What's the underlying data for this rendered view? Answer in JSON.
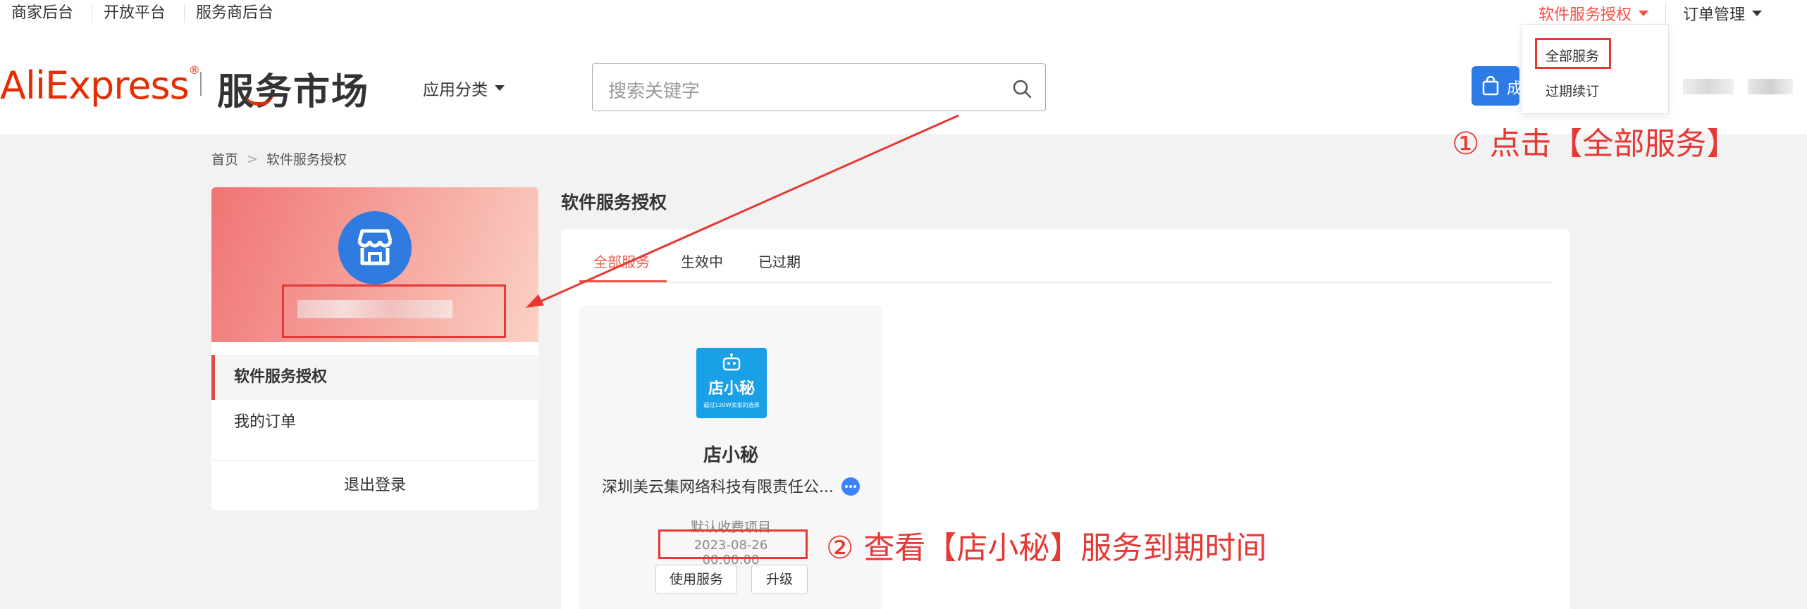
{
  "topbar": {
    "links": [
      "商家后台",
      "开放平台",
      "服务商后台"
    ],
    "auth_menu": "软件服务授权",
    "order_menu": "订单管理"
  },
  "header": {
    "logo_text": "AliExpress",
    "logo_sup": "®",
    "logo_cn": "服务市场",
    "category_menu": "应用分类",
    "search": {
      "placeholder": "搜索关键字"
    },
    "cta_label": "成"
  },
  "dropdown": {
    "items": [
      "全部服务",
      "过期续订"
    ]
  },
  "annotations": {
    "step1": "① 点击【全部服务】",
    "step2": "② 查看【店小秘】服务到期时间"
  },
  "breadcrumb": [
    "首页",
    "软件服务授权"
  ],
  "sidebar": {
    "items": [
      "软件服务授权",
      "我的订单"
    ],
    "logout": "退出登录"
  },
  "main": {
    "title": "软件服务授权",
    "tabs": [
      "全部服务",
      "生效中",
      "已过期"
    ],
    "card": {
      "app_logo_text": "店小秘",
      "app_logo_subtext": "超过120W卖家的选择",
      "app_name": "店小秘",
      "company": "深圳美云集网络科技有限责任公...",
      "plan": "默认收费项目",
      "expiry": "2023-08-26 00:00:00",
      "use_button": "使用服务",
      "upgrade_button": "升级"
    }
  },
  "colors": {
    "accent_red": "#e53935",
    "ae_red": "#e62e04",
    "tab_active": "#f05a4a",
    "store_blue": "#2f7be0",
    "app_blue": "#1aa0e6"
  }
}
